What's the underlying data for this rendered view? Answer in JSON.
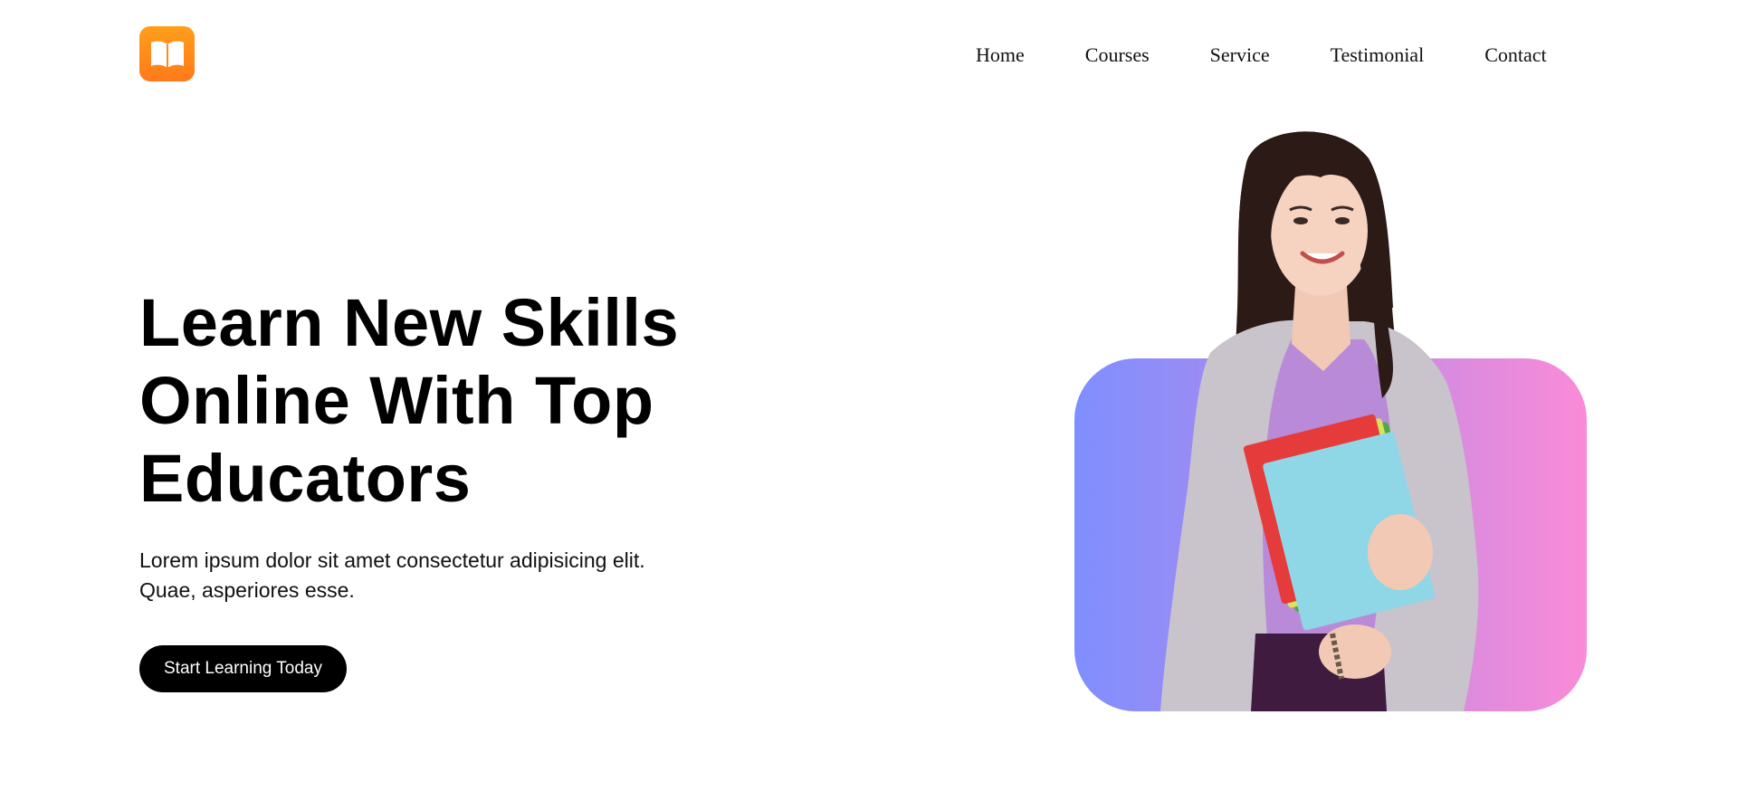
{
  "header": {
    "logo_icon": "open-book-icon",
    "brand_color": "#ff8a1a",
    "nav": [
      {
        "label": "Home"
      },
      {
        "label": "Courses"
      },
      {
        "label": "Service"
      },
      {
        "label": "Testimonial"
      },
      {
        "label": "Contact"
      }
    ]
  },
  "hero": {
    "title_lines": [
      "Learn New Skills",
      "Online With Top",
      "Educators"
    ],
    "description_lines": [
      "Lorem ipsum dolor sit amet consectetur adipisicing elit.",
      "Quae, asperiores esse."
    ],
    "cta_label": "Start Learning Today",
    "image_subject": "smiling-woman-holding-books",
    "card_gradient": [
      "#7f8ffe",
      "#fa8bd8"
    ]
  }
}
